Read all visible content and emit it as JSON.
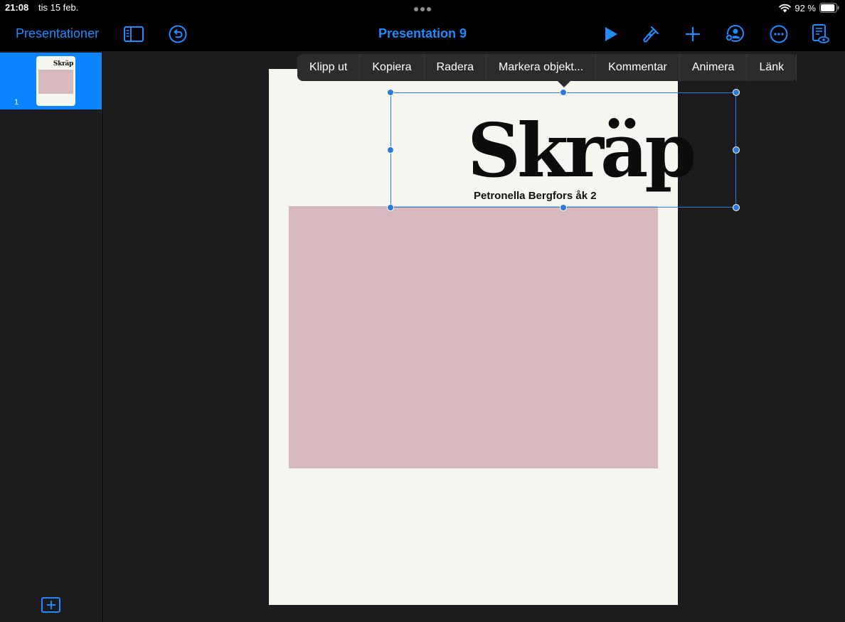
{
  "status_bar": {
    "time": "21:08",
    "date": "tis 15 feb.",
    "battery_percent": "92 %",
    "wifi_icon": "wifi-icon",
    "battery_icon": "battery-icon",
    "battery_level": 0.92
  },
  "toolbar": {
    "back_label": "Presentationer",
    "title": "Presentation 9",
    "icons": [
      "sidebar-toggle-icon",
      "undo-icon",
      "play-icon",
      "paintbrush-icon",
      "plus-icon",
      "collaborate-icon",
      "more-icon",
      "presenter-notes-icon"
    ]
  },
  "sidebar": {
    "slides": [
      {
        "number": "1",
        "thumbnail_title": "Skräp"
      }
    ],
    "add_slide_icon": "add-slide-icon"
  },
  "slide": {
    "title": "Skräp",
    "subtitle": "Petronella Bergfors åk 2",
    "rect_color": "#d5b9bd",
    "background": "#f5f6f0"
  },
  "context_menu": {
    "items": [
      "Klipp ut",
      "Kopiera",
      "Radera",
      "Markera objekt...",
      "Kommentar",
      "Animera",
      "Länk"
    ]
  },
  "colors": {
    "accent": "#1f8bff",
    "selection": "#2c7bd8",
    "selected_slide_bg": "#0a84ff"
  }
}
